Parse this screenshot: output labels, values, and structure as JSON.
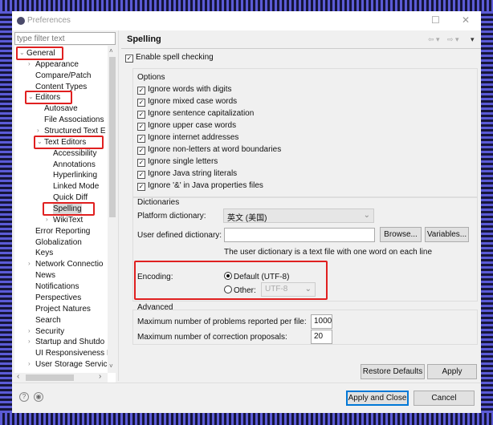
{
  "window": {
    "title": "Preferences",
    "minimize": "—",
    "maximize": "☐",
    "close": "✕"
  },
  "filter": {
    "placeholder": "type filter text"
  },
  "tree": [
    {
      "label": "General",
      "level": 0,
      "expander": "⌄",
      "highlight": true
    },
    {
      "label": "Appearance",
      "level": 1,
      "expander": "›"
    },
    {
      "label": "Compare/Patch",
      "level": 1
    },
    {
      "label": "Content Types",
      "level": 1
    },
    {
      "label": "Editors",
      "level": 1,
      "expander": "⌄",
      "highlight": true
    },
    {
      "label": "Autosave",
      "level": 2
    },
    {
      "label": "File Associations",
      "level": 2
    },
    {
      "label": "Structured Text E",
      "level": 2,
      "expander": "›"
    },
    {
      "label": "Text Editors",
      "level": 2,
      "expander": "⌄",
      "highlight": true
    },
    {
      "label": "Accessibility",
      "level": 3
    },
    {
      "label": "Annotations",
      "level": 3
    },
    {
      "label": "Hyperlinking",
      "level": 3
    },
    {
      "label": "Linked Mode",
      "level": 3
    },
    {
      "label": "Quick Diff",
      "level": 3
    },
    {
      "label": "Spelling",
      "level": 3,
      "selected": true,
      "highlight": true
    },
    {
      "label": "WikiText",
      "level": 3,
      "expander": "›"
    },
    {
      "label": "Error Reporting",
      "level": 1
    },
    {
      "label": "Globalization",
      "level": 1
    },
    {
      "label": "Keys",
      "level": 1
    },
    {
      "label": "Network Connectio",
      "level": 1,
      "expander": "›"
    },
    {
      "label": "News",
      "level": 1
    },
    {
      "label": "Notifications",
      "level": 1
    },
    {
      "label": "Perspectives",
      "level": 1
    },
    {
      "label": "Project Natures",
      "level": 1
    },
    {
      "label": "Search",
      "level": 1
    },
    {
      "label": "Security",
      "level": 1,
      "expander": "›"
    },
    {
      "label": "Startup and Shutdo",
      "level": 1,
      "expander": "›"
    },
    {
      "label": "UI Responsiveness I",
      "level": 1
    },
    {
      "label": "User Storage Servic",
      "level": 1,
      "expander": "›"
    }
  ],
  "page": {
    "title": "Spelling",
    "nav": {
      "back": "⇦ ▾",
      "forward": "⇨ ▾",
      "menu": "▾"
    },
    "enable_spell": {
      "label": "Enable spell checking",
      "checked": true
    },
    "options": {
      "title": "Options",
      "items": [
        {
          "label": "Ignore words with digits",
          "checked": true
        },
        {
          "label": "Ignore mixed case words",
          "checked": true
        },
        {
          "label": "Ignore sentence capitalization",
          "checked": true
        },
        {
          "label": "Ignore upper case words",
          "checked": true
        },
        {
          "label": "Ignore internet addresses",
          "checked": true
        },
        {
          "label": "Ignore non-letters at word boundaries",
          "checked": true
        },
        {
          "label": "Ignore single letters",
          "checked": true
        },
        {
          "label": "Ignore Java string literals",
          "checked": true
        },
        {
          "label": "Ignore '&' in Java properties files",
          "checked": true
        }
      ]
    },
    "dictionaries": {
      "title": "Dictionaries",
      "platform_label": "Platform dictionary:",
      "platform_value": "英文 (美国)",
      "user_label": "User defined dictionary:",
      "user_value": "",
      "browse": "Browse...",
      "variables": "Variables...",
      "note": "The user dictionary is a text file with one word on each line"
    },
    "encoding": {
      "label": "Encoding:",
      "default_label": "Default (UTF-8)",
      "other_label": "Other:",
      "other_value": "UTF-8",
      "selected": "default"
    },
    "advanced": {
      "title": "Advanced",
      "max_problems_label": "Maximum number of problems reported per file:",
      "max_problems": "1000",
      "max_proposals_label": "Maximum number of correction proposals:",
      "max_proposals": "20"
    },
    "restore_defaults": "Restore Defaults",
    "apply": "Apply"
  },
  "footer": {
    "help": "?",
    "import": "◉",
    "apply_close": "Apply and Close",
    "cancel": "Cancel"
  },
  "colors": {
    "highlight": "#e02020",
    "frame_blue": "#5b5bd6",
    "frame_dark": "#15153a"
  }
}
